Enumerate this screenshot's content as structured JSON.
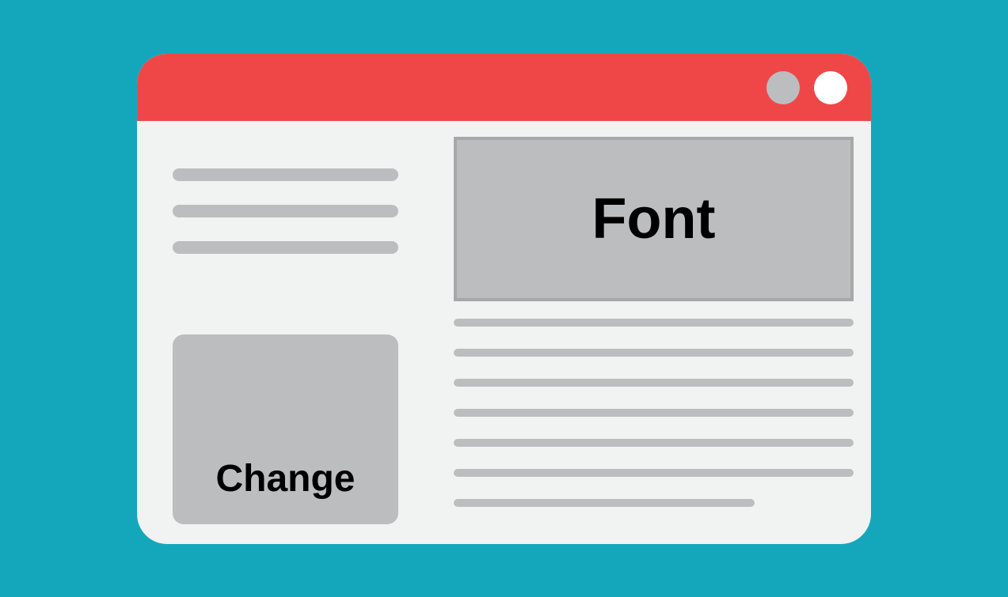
{
  "hero": {
    "label": "Font"
  },
  "card": {
    "label": "Change"
  }
}
